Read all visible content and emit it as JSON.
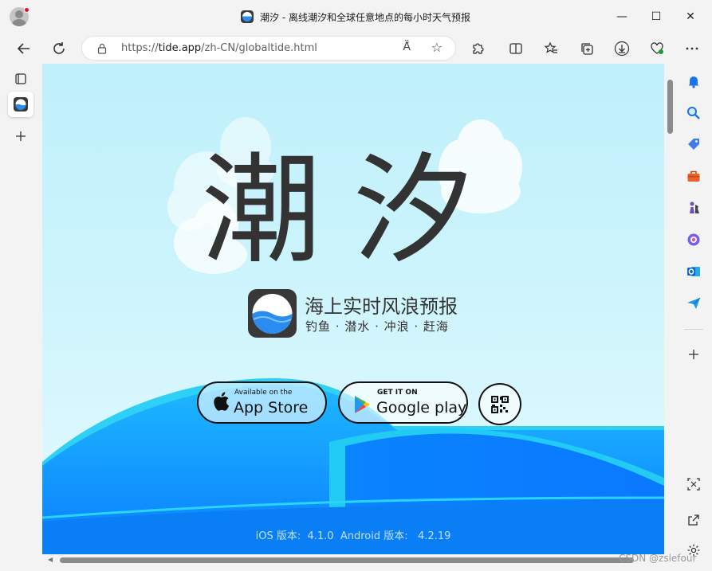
{
  "window": {
    "title": "潮汐 - 离线潮汐和全球任意地点的每小时天气预报",
    "controls": {
      "minimize": "—",
      "maximize": "☐",
      "close": "✕"
    }
  },
  "toolbar": {
    "url_prefix": "https://",
    "url_host": "tide.app",
    "url_path": "/zh-CN/globaltide.html",
    "read_aloud": "Ä́",
    "favorite": "☆"
  },
  "page": {
    "hero": "潮汐",
    "tagline": "海上实时风浪预报",
    "subline": "钓鱼 · 潜水 · 冲浪 · 赶海",
    "appstore": {
      "small": "Available on the",
      "big": "App Store"
    },
    "googleplay": {
      "small": "GET IT ON",
      "big": "Google play"
    },
    "version": "iOS 版本:  4.1.0  Android 版本:   4.2.19",
    "colors": {
      "sky": "#c4f1fc",
      "wave_dark": "#0a84ff",
      "wave_light": "#24c7f2",
      "text": "#333333"
    }
  },
  "watermark": "CSDN @zslefour"
}
